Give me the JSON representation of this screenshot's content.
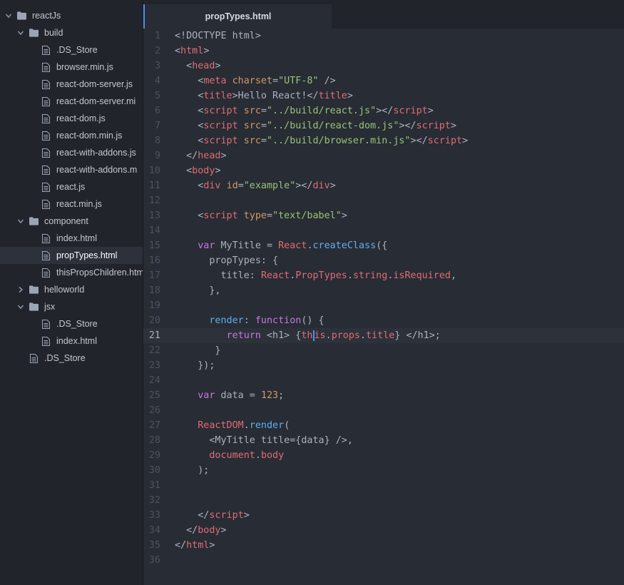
{
  "sidebar": {
    "items": [
      {
        "label": "reactJs",
        "type": "folder",
        "expanded": true,
        "depth": 0
      },
      {
        "label": "build",
        "type": "folder",
        "expanded": true,
        "depth": 1
      },
      {
        "label": ".DS_Store",
        "type": "file",
        "depth": 2
      },
      {
        "label": "browser.min.js",
        "type": "file",
        "depth": 2
      },
      {
        "label": "react-dom-server.js",
        "type": "file",
        "depth": 2
      },
      {
        "label": "react-dom-server.mi",
        "type": "file",
        "depth": 2
      },
      {
        "label": "react-dom.js",
        "type": "file",
        "depth": 2
      },
      {
        "label": "react-dom.min.js",
        "type": "file",
        "depth": 2
      },
      {
        "label": "react-with-addons.js",
        "type": "file",
        "depth": 2
      },
      {
        "label": "react-with-addons.m",
        "type": "file",
        "depth": 2
      },
      {
        "label": "react.js",
        "type": "file",
        "depth": 2
      },
      {
        "label": "react.min.js",
        "type": "file",
        "depth": 2
      },
      {
        "label": "component",
        "type": "folder",
        "expanded": true,
        "depth": 1
      },
      {
        "label": "index.html",
        "type": "file",
        "depth": 2
      },
      {
        "label": "propTypes.html",
        "type": "file",
        "depth": 2,
        "selected": true
      },
      {
        "label": "thisPropsChildren.htm",
        "type": "file",
        "depth": 2
      },
      {
        "label": "helloworld",
        "type": "folder",
        "expanded": false,
        "depth": 1
      },
      {
        "label": "jsx",
        "type": "folder",
        "expanded": true,
        "depth": 1
      },
      {
        "label": ".DS_Store",
        "type": "file",
        "depth": 2
      },
      {
        "label": "index.html",
        "type": "file",
        "depth": 2
      },
      {
        "label": ".DS_Store",
        "type": "file",
        "depth": 1
      }
    ]
  },
  "tabs": [
    {
      "label": "propTypes.html",
      "active": true
    }
  ],
  "editor": {
    "current_line": 21,
    "lines": [
      [
        [
          "default",
          "<!DOCTYPE html>"
        ]
      ],
      [
        [
          "default",
          "<"
        ],
        [
          "tag",
          "html"
        ],
        [
          "default",
          ">"
        ]
      ],
      [
        [
          "default",
          "  <"
        ],
        [
          "tag",
          "head"
        ],
        [
          "default",
          ">"
        ]
      ],
      [
        [
          "default",
          "    <"
        ],
        [
          "tag",
          "meta"
        ],
        [
          "default",
          " "
        ],
        [
          "attr",
          "charset"
        ],
        [
          "default",
          "="
        ],
        [
          "string",
          "\"UTF-8\""
        ],
        [
          "default",
          " />"
        ]
      ],
      [
        [
          "default",
          "    <"
        ],
        [
          "tag",
          "title"
        ],
        [
          "default",
          ">Hello React!</"
        ],
        [
          "tag",
          "title"
        ],
        [
          "default",
          ">"
        ]
      ],
      [
        [
          "default",
          "    <"
        ],
        [
          "tag",
          "script"
        ],
        [
          "default",
          " "
        ],
        [
          "attr",
          "src"
        ],
        [
          "default",
          "="
        ],
        [
          "string",
          "\"../build/react.js\""
        ],
        [
          "default",
          "></"
        ],
        [
          "tag",
          "script"
        ],
        [
          "default",
          ">"
        ]
      ],
      [
        [
          "default",
          "    <"
        ],
        [
          "tag",
          "script"
        ],
        [
          "default",
          " "
        ],
        [
          "attr",
          "src"
        ],
        [
          "default",
          "="
        ],
        [
          "string",
          "\"../build/react-dom.js\""
        ],
        [
          "default",
          "></"
        ],
        [
          "tag",
          "script"
        ],
        [
          "default",
          ">"
        ]
      ],
      [
        [
          "default",
          "    <"
        ],
        [
          "tag",
          "script"
        ],
        [
          "default",
          " "
        ],
        [
          "attr",
          "src"
        ],
        [
          "default",
          "="
        ],
        [
          "string",
          "\"../build/browser.min.js\""
        ],
        [
          "default",
          "></"
        ],
        [
          "tag",
          "script"
        ],
        [
          "default",
          ">"
        ]
      ],
      [
        [
          "default",
          "  </"
        ],
        [
          "tag",
          "head"
        ],
        [
          "default",
          ">"
        ]
      ],
      [
        [
          "default",
          "  <"
        ],
        [
          "tag",
          "body"
        ],
        [
          "default",
          ">"
        ]
      ],
      [
        [
          "default",
          "    <"
        ],
        [
          "tag",
          "div"
        ],
        [
          "default",
          " "
        ],
        [
          "attr",
          "id"
        ],
        [
          "default",
          "="
        ],
        [
          "string",
          "\"example\""
        ],
        [
          "default",
          "></"
        ],
        [
          "tag",
          "div"
        ],
        [
          "default",
          ">"
        ]
      ],
      [],
      [
        [
          "default",
          "    <"
        ],
        [
          "tag",
          "script"
        ],
        [
          "default",
          " "
        ],
        [
          "attr",
          "type"
        ],
        [
          "default",
          "="
        ],
        [
          "string",
          "\"text/babel\""
        ],
        [
          "default",
          ">"
        ]
      ],
      [],
      [
        [
          "keyword",
          "    var"
        ],
        [
          "default",
          " MyTitle = "
        ],
        [
          "var",
          "React"
        ],
        [
          "default",
          "."
        ],
        [
          "func",
          "createClass"
        ],
        [
          "default",
          "({"
        ]
      ],
      [
        [
          "default",
          "      propTypes: {"
        ]
      ],
      [
        [
          "default",
          "        title: "
        ],
        [
          "var",
          "React"
        ],
        [
          "default",
          "."
        ],
        [
          "var",
          "PropTypes"
        ],
        [
          "default",
          "."
        ],
        [
          "var",
          "string"
        ],
        [
          "default",
          "."
        ],
        [
          "var",
          "isRequired"
        ],
        [
          "default",
          ","
        ]
      ],
      [
        [
          "default",
          "      },"
        ]
      ],
      [],
      [
        [
          "func",
          "      render"
        ],
        [
          "default",
          ": "
        ],
        [
          "keyword",
          "function"
        ],
        [
          "default",
          "() {"
        ]
      ],
      [
        [
          "default",
          "         "
        ],
        [
          "keyword",
          "return"
        ],
        [
          "default",
          " <h1> {"
        ],
        [
          "var",
          "th"
        ],
        [
          "cursor",
          ""
        ],
        [
          "var",
          "is"
        ],
        [
          "default",
          "."
        ],
        [
          "var",
          "props"
        ],
        [
          "default",
          "."
        ],
        [
          "var",
          "title"
        ],
        [
          "default",
          "} </h1>;"
        ]
      ],
      [
        [
          "default",
          "       }"
        ]
      ],
      [
        [
          "default",
          "    });"
        ]
      ],
      [],
      [
        [
          "keyword",
          "    var"
        ],
        [
          "default",
          " data = "
        ],
        [
          "number",
          "123"
        ],
        [
          "default",
          ";"
        ]
      ],
      [],
      [
        [
          "var",
          "    ReactDOM"
        ],
        [
          "default",
          "."
        ],
        [
          "func",
          "render"
        ],
        [
          "default",
          "("
        ]
      ],
      [
        [
          "default",
          "      <MyTitle title={data} />,"
        ]
      ],
      [
        [
          "var",
          "      document"
        ],
        [
          "default",
          "."
        ],
        [
          "var",
          "body"
        ]
      ],
      [
        [
          "default",
          "    );"
        ]
      ],
      [],
      [],
      [
        [
          "default",
          "    </"
        ],
        [
          "tag",
          "script"
        ],
        [
          "default",
          ">"
        ]
      ],
      [
        [
          "default",
          "  </"
        ],
        [
          "tag",
          "body"
        ],
        [
          "default",
          ">"
        ]
      ],
      [
        [
          "default",
          "</"
        ],
        [
          "tag",
          "html"
        ],
        [
          "default",
          ">"
        ]
      ],
      []
    ]
  },
  "colors": {
    "sidebar_bg": "#21252b",
    "editor_bg": "#282c34",
    "accent": "#568af2",
    "tag": "#e06c75",
    "string": "#98c379",
    "keyword": "#c678dd",
    "function": "#61afef",
    "attribute": "#d19a66"
  }
}
